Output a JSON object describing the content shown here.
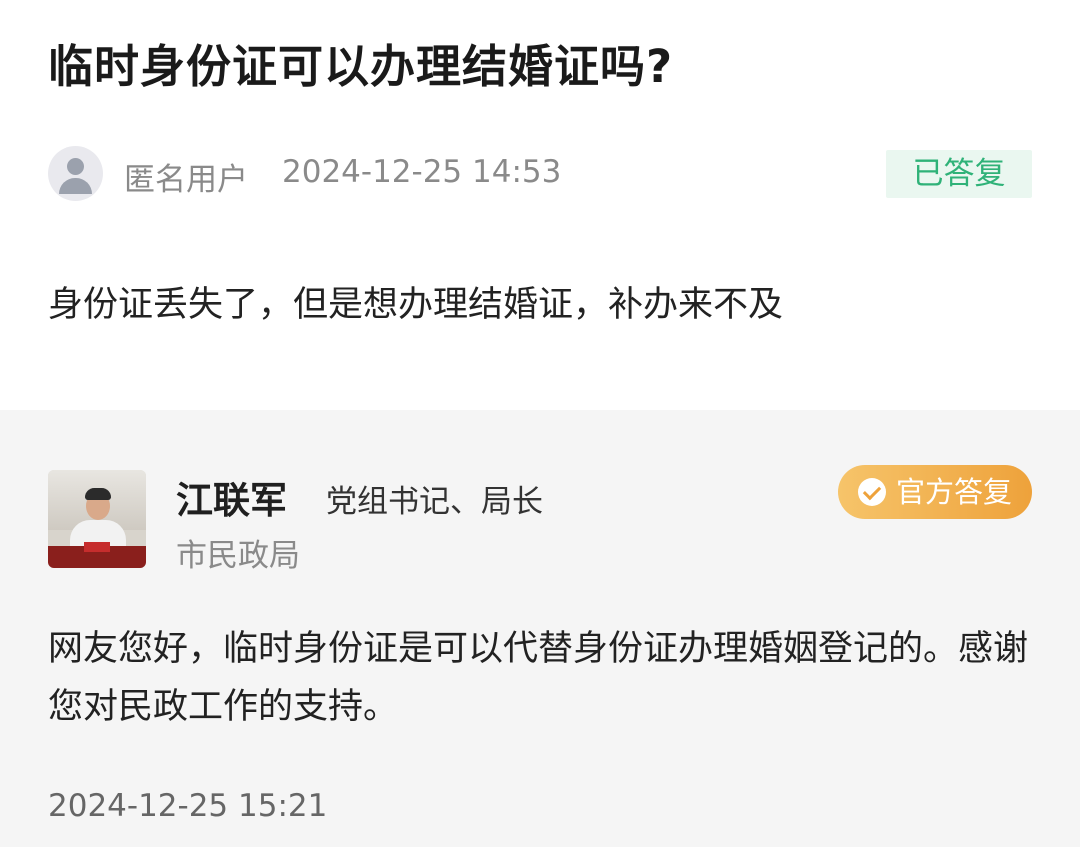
{
  "question": {
    "title": "临时身份证可以办理结婚证吗?",
    "author": "匿名用户",
    "time": "2024-12-25 14:53",
    "status": "已答复",
    "body": "身份证丢失了，但是想办理结婚证，补办来不及"
  },
  "answer": {
    "official_name": "江联军",
    "official_title": "党组书记、局长",
    "department": "市民政局",
    "badge": "官方答复",
    "text": "网友您好，临时身份证是可以代替身份证办理婚姻登记的。感谢您对民政工作的支持。",
    "time": "2024-12-25 15:21"
  },
  "colors": {
    "status_green": "#2fb278",
    "badge_orange": "#eea23b",
    "answer_bg": "#f5f5f5"
  }
}
